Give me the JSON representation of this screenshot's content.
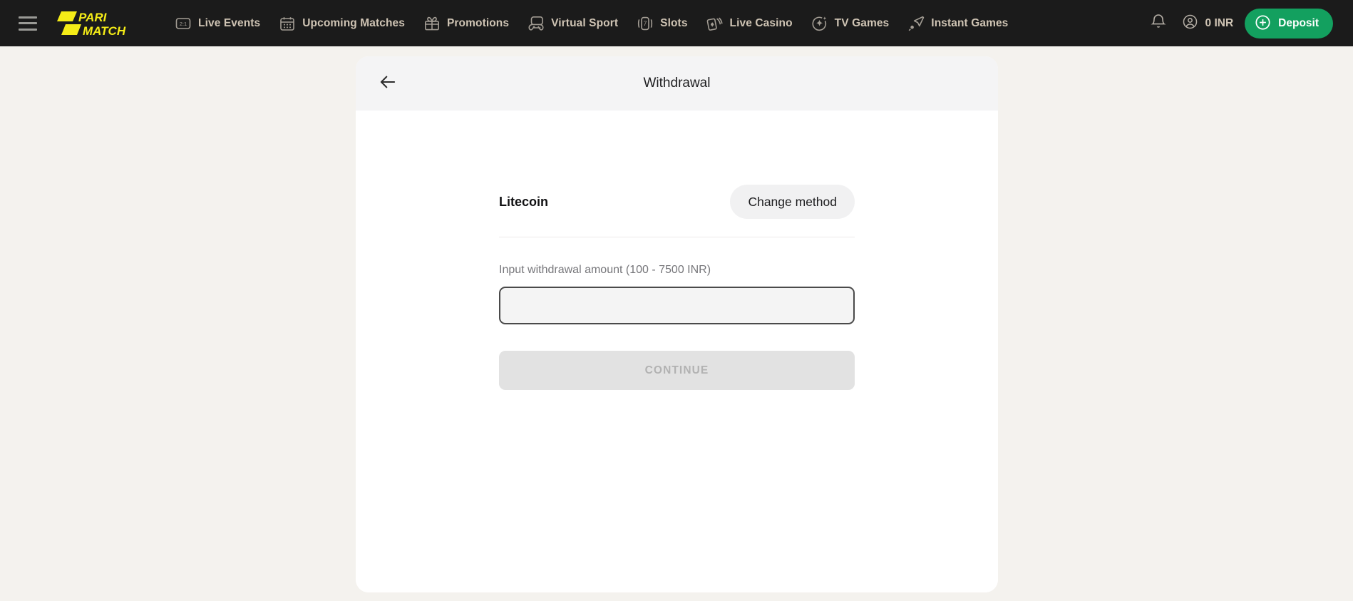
{
  "header": {
    "menu_icon": "hamburger-menu-icon",
    "logo_line1": "PARI",
    "logo_line2": "MATCH",
    "nav": [
      {
        "label": "Live Events",
        "icon": "live-score-icon"
      },
      {
        "label": "Upcoming Matches",
        "icon": "calendar-icon"
      },
      {
        "label": "Promotions",
        "icon": "gift-icon"
      },
      {
        "label": "Virtual Sport",
        "icon": "gamepad-icon"
      },
      {
        "label": "Slots",
        "icon": "slot-seven-icon"
      },
      {
        "label": "Live Casino",
        "icon": "playing-cards-icon"
      },
      {
        "label": "TV Games",
        "icon": "sparkle-icon"
      },
      {
        "label": "Instant Games",
        "icon": "rocket-icon"
      }
    ],
    "notifications_icon": "bell-icon",
    "account_icon": "user-circle-icon",
    "balance": "0 INR",
    "deposit_label": "Deposit",
    "deposit_icon": "plus-circle-icon",
    "deposit_color": "#13a05f",
    "brand_color": "#f5ec17",
    "bar_color": "#1b1b1b"
  },
  "card": {
    "back_icon": "arrow-left-icon",
    "title": "Withdrawal",
    "method_name": "Litecoin",
    "change_method_label": "Change method",
    "amount_label": "Input withdrawal amount (100 - 7500 INR)",
    "amount_value": "",
    "amount_placeholder": "",
    "continue_label": "CONTINUE"
  }
}
